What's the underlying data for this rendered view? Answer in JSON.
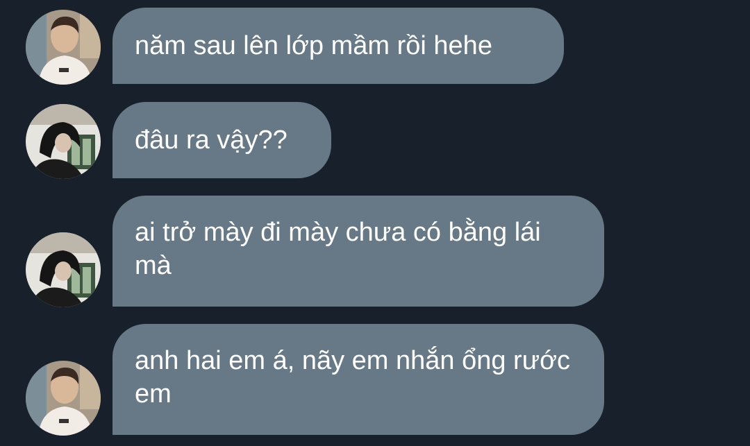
{
  "messages": [
    {
      "text": "năm sau lên lớp mầm rồi hehe",
      "avatar": "avatar-boy-white-shirt"
    },
    {
      "text": "đâu ra vậy??",
      "avatar": "avatar-dark-hair"
    },
    {
      "text": "ai trở mày đi mày chưa có bằng lái mà",
      "avatar": "avatar-dark-hair"
    },
    {
      "text": "anh hai em á, nãy em nhắn ổng rước em",
      "avatar": "avatar-boy-white-shirt"
    }
  ],
  "colors": {
    "background": "#18202b",
    "bubble": "#677987",
    "text": "#ffffff"
  }
}
